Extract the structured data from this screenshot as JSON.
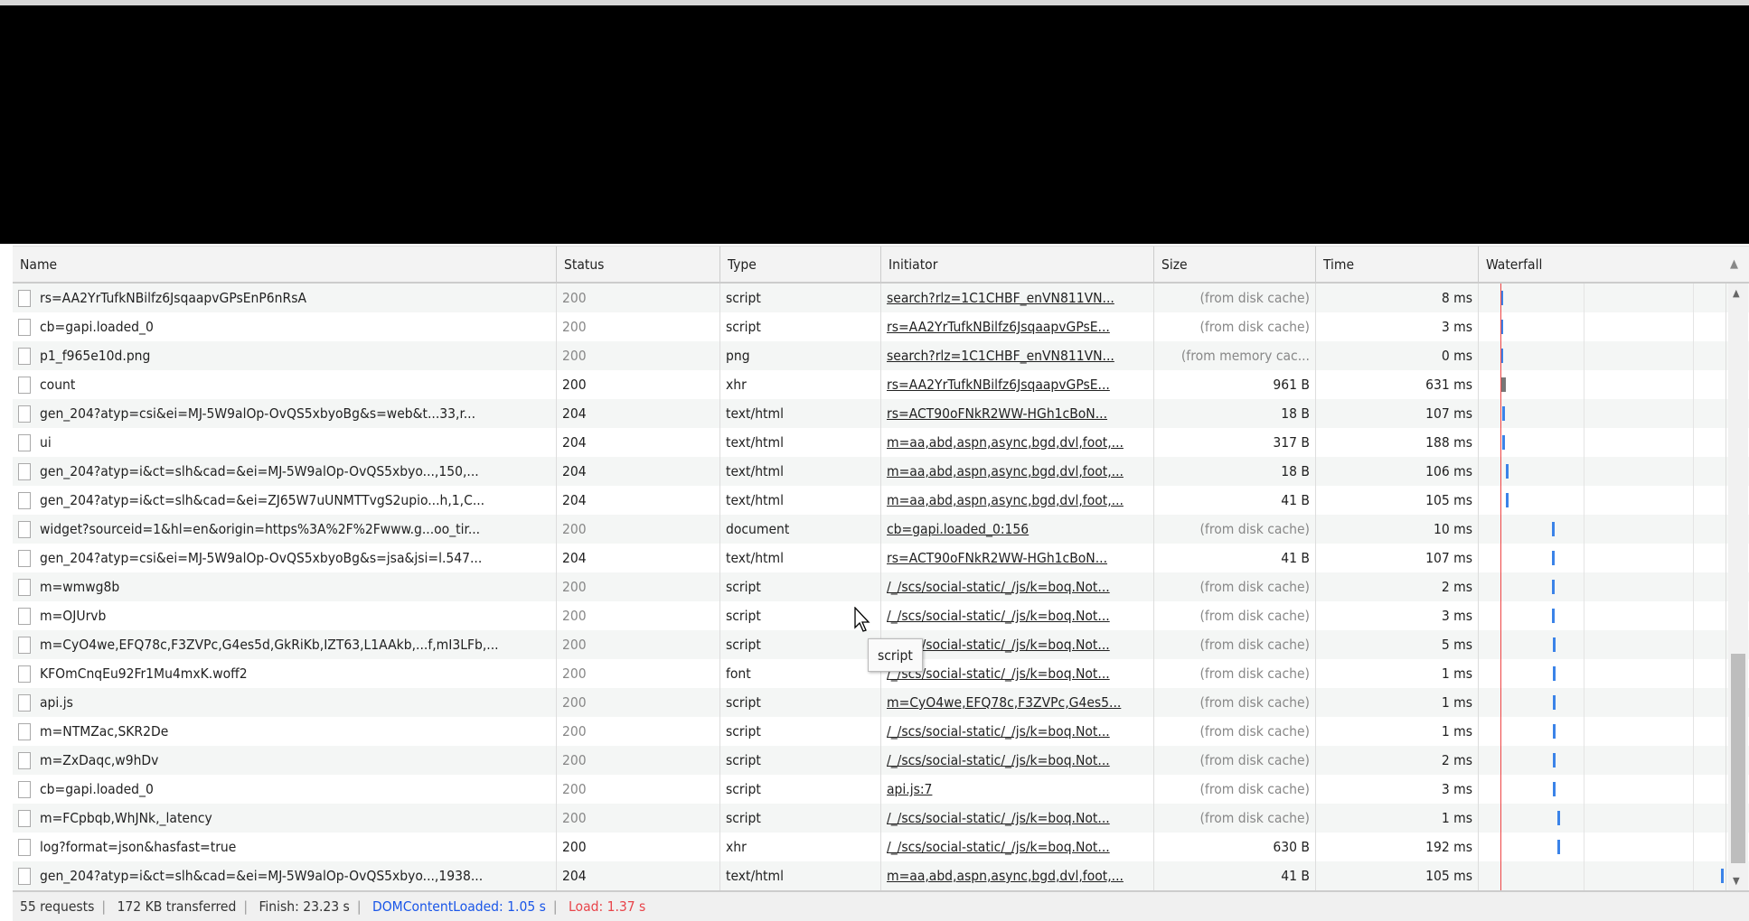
{
  "columns": [
    "Name",
    "Status",
    "Type",
    "Initiator",
    "Size",
    "Time",
    "Waterfall"
  ],
  "rows": [
    {
      "name": "rs=AA2YrTufkNBilfz6JsqaapvGPsEnP6nRsA",
      "status": "200",
      "type": "script",
      "initiator": "search?rlz=1C1CHBF_enVN811VN...",
      "size": "(from disk cache)",
      "time": "8 ms",
      "dim": true,
      "wf": 0.088
    },
    {
      "name": "cb=gapi.loaded_0",
      "status": "200",
      "type": "script",
      "initiator": "rs=AA2YrTufkNBilfz6JsqaapvGPsE...",
      "size": "(from disk cache)",
      "time": "3 ms",
      "dim": true,
      "wf": 0.088
    },
    {
      "name": "p1_f965e10d.png",
      "status": "200",
      "type": "png",
      "initiator": "search?rlz=1C1CHBF_enVN811VN...",
      "size": "(from memory cac...",
      "time": "0 ms",
      "dim": true,
      "wf": 0.088
    },
    {
      "name": "count",
      "status": "200",
      "type": "xhr",
      "initiator": "rs=AA2YrTufkNBilfz6JsqaapvGPsE...",
      "size": "961 B",
      "time": "631 ms",
      "dim": false,
      "wf": 0.09,
      "gray": true
    },
    {
      "name": "gen_204?atyp=csi&ei=MJ-5W9alOp-OvQS5xbyoBg&s=web&t...33,r...",
      "status": "204",
      "type": "text/html",
      "initiator": "rs=ACT90oFNkR2WW-HGh1cBoN...",
      "size": "18 B",
      "time": "107 ms",
      "dim": false,
      "wf": 0.095
    },
    {
      "name": "ui",
      "status": "204",
      "type": "text/html",
      "initiator": "m=aa,abd,aspn,async,bgd,dvl,foot,...",
      "size": "317 B",
      "time": "188 ms",
      "dim": false,
      "wf": 0.095
    },
    {
      "name": "gen_204?atyp=i&ct=slh&cad=&ei=MJ-5W9alOp-OvQS5xbyo...,150,...",
      "status": "204",
      "type": "text/html",
      "initiator": "m=aa,abd,aspn,async,bgd,dvl,foot,...",
      "size": "18 B",
      "time": "106 ms",
      "dim": false,
      "wf": 0.11
    },
    {
      "name": "gen_204?atyp=i&ct=slh&cad=&ei=ZJ65W7uUNMTTvgS2upio...h,1,C...",
      "status": "204",
      "type": "text/html",
      "initiator": "m=aa,abd,aspn,async,bgd,dvl,foot,...",
      "size": "41 B",
      "time": "105 ms",
      "dim": false,
      "wf": 0.11
    },
    {
      "name": "widget?sourceid=1&hl=en&origin=https%3A%2F%2Fwww.g...oo_tir...",
      "status": "200",
      "type": "document",
      "initiator": "cb=gapi.loaded_0:156",
      "size": "(from disk cache)",
      "time": "10 ms",
      "dim": true,
      "wf": 0.3
    },
    {
      "name": "gen_204?atyp=csi&ei=MJ-5W9alOp-OvQS5xbyoBg&s=jsa&jsi=l.547...",
      "status": "204",
      "type": "text/html",
      "initiator": "rs=ACT90oFNkR2WW-HGh1cBoN...",
      "size": "41 B",
      "time": "107 ms",
      "dim": false,
      "wf": 0.3
    },
    {
      "name": "m=wmwg8b",
      "status": "200",
      "type": "script",
      "initiator": "/_/scs/social-static/_/js/k=boq.Not...",
      "size": "(from disk cache)",
      "time": "2 ms",
      "dim": true,
      "wf": 0.3
    },
    {
      "name": "m=OJUrvb",
      "status": "200",
      "type": "script",
      "initiator": "/_/scs/social-static/_/js/k=boq.Not...",
      "size": "(from disk cache)",
      "time": "3 ms",
      "dim": true,
      "wf": 0.3
    },
    {
      "name": "m=CyO4we,EFQ78c,F3ZVPc,G4es5d,GkRiKb,IZT63,L1AAkb,...f,mI3LFb,...",
      "status": "200",
      "type": "script",
      "initiator": "/_/scs/social-static/_/js/k=boq.Not...",
      "size": "(from disk cache)",
      "time": "5 ms",
      "dim": true,
      "wf": 0.302
    },
    {
      "name": "KFOmCnqEu92Fr1Mu4mxK.woff2",
      "status": "200",
      "type": "font",
      "initiator": "/_/scs/social-static/_/js/k=boq.Not...",
      "size": "(from disk cache)",
      "time": "1 ms",
      "dim": true,
      "wf": 0.302
    },
    {
      "name": "api.js",
      "status": "200",
      "type": "script",
      "initiator": "m=CyO4we,EFQ78c,F3ZVPc,G4es5...",
      "size": "(from disk cache)",
      "time": "1 ms",
      "dim": true,
      "wf": 0.302
    },
    {
      "name": "m=NTMZac,SKR2De",
      "status": "200",
      "type": "script",
      "initiator": "/_/scs/social-static/_/js/k=boq.Not...",
      "size": "(from disk cache)",
      "time": "1 ms",
      "dim": true,
      "wf": 0.302
    },
    {
      "name": "m=ZxDaqc,w9hDv",
      "status": "200",
      "type": "script",
      "initiator": "/_/scs/social-static/_/js/k=boq.Not...",
      "size": "(from disk cache)",
      "time": "2 ms",
      "dim": true,
      "wf": 0.302
    },
    {
      "name": "cb=gapi.loaded_0",
      "status": "200",
      "type": "script",
      "initiator": "api.js:7",
      "size": "(from disk cache)",
      "time": "3 ms",
      "dim": true,
      "wf": 0.302
    },
    {
      "name": "m=FCpbqb,WhJNk,_latency",
      "status": "200",
      "type": "script",
      "initiator": "/_/scs/social-static/_/js/k=boq.Not...",
      "size": "(from disk cache)",
      "time": "1 ms",
      "dim": true,
      "wf": 0.32
    },
    {
      "name": "log?format=json&hasfast=true",
      "status": "200",
      "type": "xhr",
      "initiator": "/_/scs/social-static/_/js/k=boq.Not...",
      "size": "630 B",
      "time": "192 ms",
      "dim": false,
      "wf": 0.322
    },
    {
      "name": "gen_204?atyp=i&ct=slh&cad=&ei=MJ-5W9alOp-OvQS5xbyo...,1938...",
      "status": "204",
      "type": "text/html",
      "initiator": "m=aa,abd,aspn,async,bgd,dvl,foot,...",
      "size": "41 B",
      "time": "105 ms",
      "dim": false,
      "wf": 0.99
    }
  ],
  "footer": {
    "requests": "55 requests",
    "transferred": "172 KB transferred",
    "finish": "Finish: 23.23 s",
    "dcl": "DOMContentLoaded: 1.05 s",
    "load": "Load: 1.37 s"
  },
  "tooltip": "script",
  "colors": {
    "dcl": "#1a56e8",
    "load": "#e8444a",
    "bar": "#3b83e8"
  }
}
